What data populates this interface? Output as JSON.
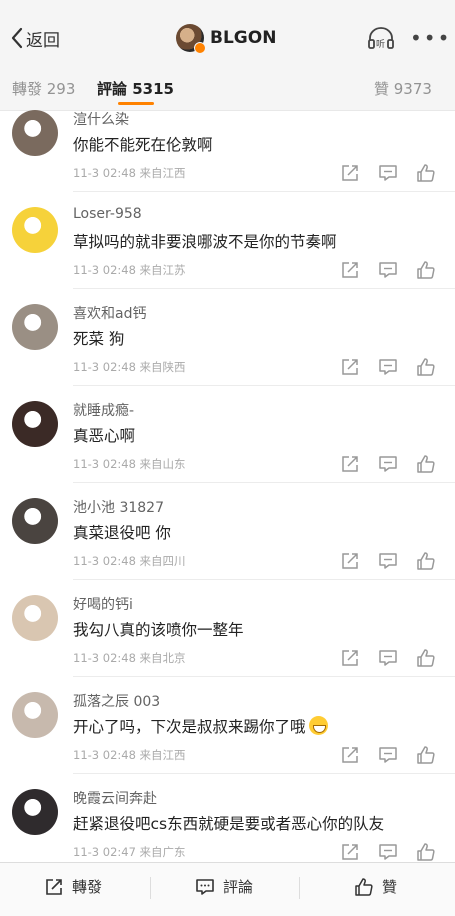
{
  "nav": {
    "back_label": "返回",
    "title": "BLGON",
    "listen_label": "听"
  },
  "tabs": {
    "repost": "轉發 293",
    "comment": "評論 5315",
    "like": "贊 9373"
  },
  "comments": [
    {
      "name": "渲什么染",
      "text": "你能不能死在伦敦啊",
      "meta": "11-3 02:48  来自江西",
      "avatar_color": "#7a6a5e"
    },
    {
      "name": "Loser-958",
      "text": "草拟吗的就非要浪哪波不是你的节奏啊",
      "meta": "11-3 02:48  来自江苏",
      "avatar_color": "#f6d23a"
    },
    {
      "name": "喜欢和ad钙",
      "text": "死菜 狗",
      "meta": "11-3 02:48  来自陕西",
      "avatar_color": "#9a8f84"
    },
    {
      "name": "就睡成瘾-",
      "text": "真恶心啊",
      "meta": "11-3 02:48  来自山东",
      "avatar_color": "#3b2a26"
    },
    {
      "name": "池小池 31827",
      "text": "真菜退役吧 你",
      "meta": "11-3 02:48  来自四川",
      "avatar_color": "#4a4440"
    },
    {
      "name": "好喝的钙i",
      "text": "我勾八真的该喷你一整年",
      "meta": "11-3 02:48  来自北京",
      "avatar_color": "#d9c6b1"
    },
    {
      "name": "孤落之辰 003",
      "text": "开心了吗，下次是叔叔来踢你了哦",
      "meta": "11-3 02:48  来自江西",
      "avatar_color": "#c7b9ad",
      "emoji": "grin"
    },
    {
      "name": "晚霞云间奔赴",
      "text": "赶紧退役吧cs东西就硬是要或者恶心你的队友",
      "meta": "11-3 02:47  来自广东",
      "avatar_color": "#2f2b2d"
    }
  ],
  "bottom": {
    "repost": "轉發",
    "comment": "評論",
    "like": "贊"
  },
  "colors": {
    "accent": "#ff8200",
    "meta_text": "#aaaaaa"
  }
}
